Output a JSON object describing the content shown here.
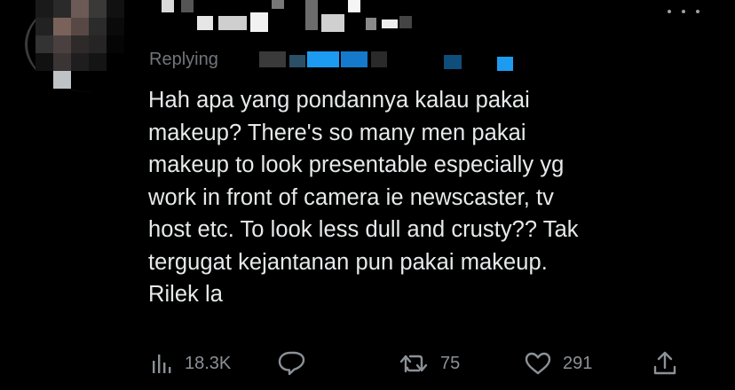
{
  "tweet": {
    "replying_label": "Replying",
    "text": "Hah apa yang pondannya kalau pakai\nmakeup? There's so many men pakai\nmakeup to look presentable especially yg\nwork in front of camera ie newscaster, tv\nhost etc. To look less dull and crusty?? Tak\ntergugat kejantanan pun pakai makeup.\nRilek la"
  },
  "actions": {
    "views": {
      "icon": "views-icon",
      "count": "18.3K"
    },
    "reply": {
      "icon": "reply-icon"
    },
    "retweet": {
      "icon": "retweet-icon",
      "count": "75"
    },
    "like": {
      "icon": "heart-icon",
      "count": "291"
    },
    "share": {
      "icon": "share-icon"
    }
  },
  "colors": {
    "background": "#000000",
    "text": "#e7e9ea",
    "secondary": "#71767b",
    "censor_blue": "#1d9bf0"
  }
}
